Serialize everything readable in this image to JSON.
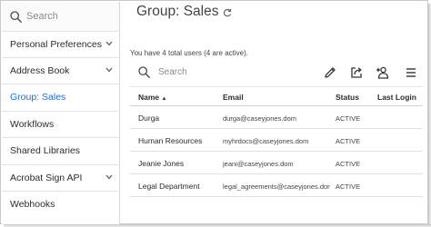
{
  "sidebar": {
    "search_placeholder": "Search",
    "items": [
      {
        "label": "Personal Preferences",
        "expandable": true,
        "active": false
      },
      {
        "label": "Address Book",
        "expandable": true,
        "active": false
      },
      {
        "label": "Group: Sales",
        "expandable": false,
        "active": true
      },
      {
        "label": "Workflows",
        "expandable": false,
        "active": false
      },
      {
        "label": "Shared Libraries",
        "expandable": false,
        "active": false
      },
      {
        "label": "Acrobat Sign API",
        "expandable": true,
        "active": false
      },
      {
        "label": "Webhooks",
        "expandable": false,
        "active": false
      }
    ]
  },
  "main": {
    "title": "Group: Sales",
    "summary": "You have 4 total users (4 are active).",
    "search_placeholder": "Search",
    "toolbar_icons": [
      "edit-pencil-icon",
      "export-share-icon",
      "add-user-icon",
      "menu-icon"
    ]
  },
  "table": {
    "columns": [
      "Name",
      "Email",
      "Status",
      "Last Login"
    ],
    "sort_column": "Name",
    "sort_direction": "ascending",
    "rows": [
      {
        "name": "Durga",
        "email": "durga@caseyjones.dom",
        "status": "ACTIVE",
        "last_login": ""
      },
      {
        "name": "Human Resources",
        "email": "myhrdocs@caseyjones.dom",
        "status": "ACTIVE",
        "last_login": ""
      },
      {
        "name": "Jeanie Jones",
        "email": "jeani@caseyjones.dom",
        "status": "ACTIVE",
        "last_login": ""
      },
      {
        "name": "Legal Department",
        "email": "legal_agreements@caseyjones.dom",
        "status": "ACTIVE",
        "last_login": ""
      }
    ]
  },
  "colors": {
    "active_link": "#1473e6",
    "text": "#2c2c2c",
    "muted": "#8a8a8a",
    "divider": "#e1e1e1"
  }
}
